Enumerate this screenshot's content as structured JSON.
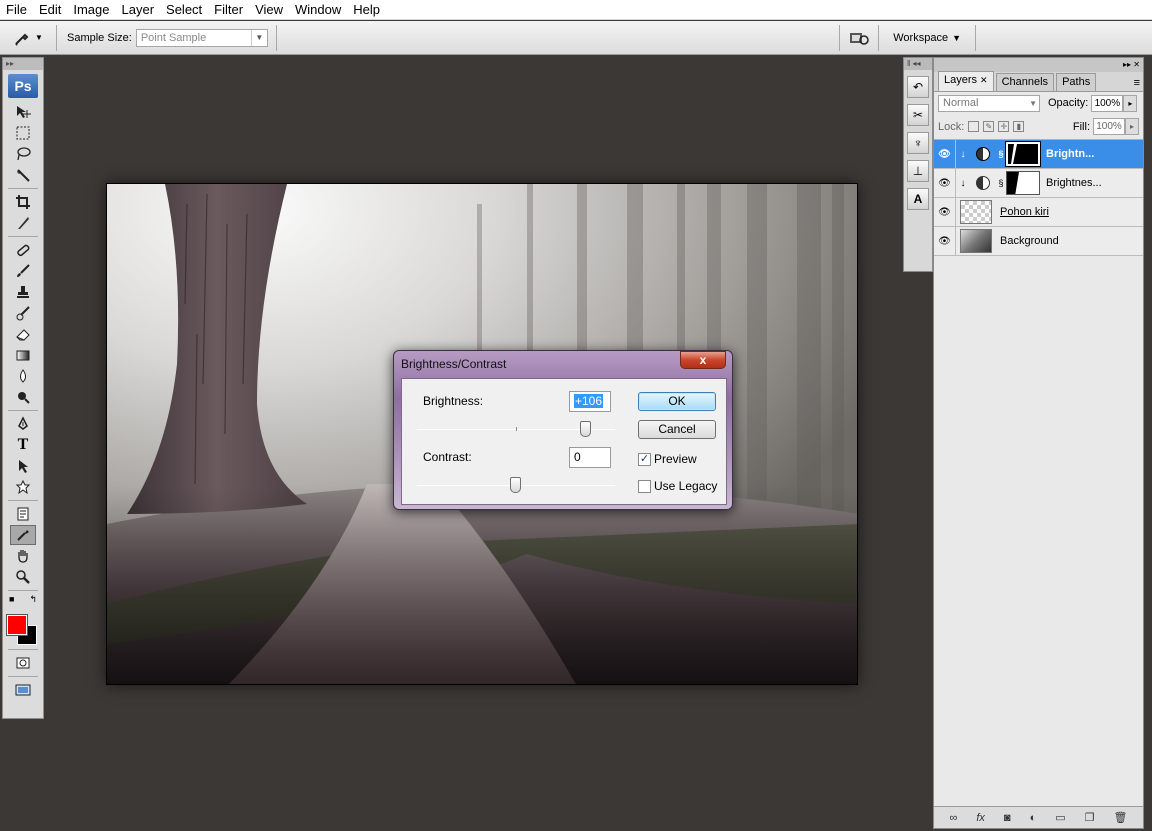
{
  "menubar": {
    "items": [
      "File",
      "Edit",
      "Image",
      "Layer",
      "Select",
      "Filter",
      "View",
      "Window",
      "Help"
    ]
  },
  "options_bar": {
    "sample_size_label": "Sample Size:",
    "sample_size_value": "Point Sample",
    "workspace_label": "Workspace"
  },
  "toolbox": {
    "logo": "Ps",
    "foreground_color": "#ff0000",
    "background_color": "#000000"
  },
  "layers_panel": {
    "tabs": [
      {
        "label": "Layers",
        "active": true
      },
      {
        "label": "Channels",
        "active": false
      },
      {
        "label": "Paths",
        "active": false
      }
    ],
    "blend_mode": "Normal",
    "opacity_label": "Opacity:",
    "opacity_value": "100%",
    "lock_label": "Lock:",
    "fill_label": "Fill:",
    "fill_value": "100%",
    "layers": [
      {
        "name": "Brightn...",
        "type": "adjustment",
        "selected": true
      },
      {
        "name": "Brightnes...",
        "type": "adjustment",
        "selected": false
      },
      {
        "name": "Pohon kiri",
        "type": "pixel",
        "selected": false
      },
      {
        "name": "Background",
        "type": "pixel",
        "selected": false
      }
    ]
  },
  "dialog": {
    "title": "Brightness/Contrast",
    "close_label": "x",
    "brightness_label": "Brightness:",
    "brightness_value": "+106",
    "contrast_label": "Contrast:",
    "contrast_value": "0",
    "ok_label": "OK",
    "cancel_label": "Cancel",
    "preview_label": "Preview",
    "preview_checked": true,
    "use_legacy_label": "Use Legacy",
    "use_legacy_checked": false
  },
  "colors": {
    "workspace_bg": "#3b3835",
    "layer_selected": "#3a8ee8",
    "dialog_frame": "#8f6ea0"
  }
}
